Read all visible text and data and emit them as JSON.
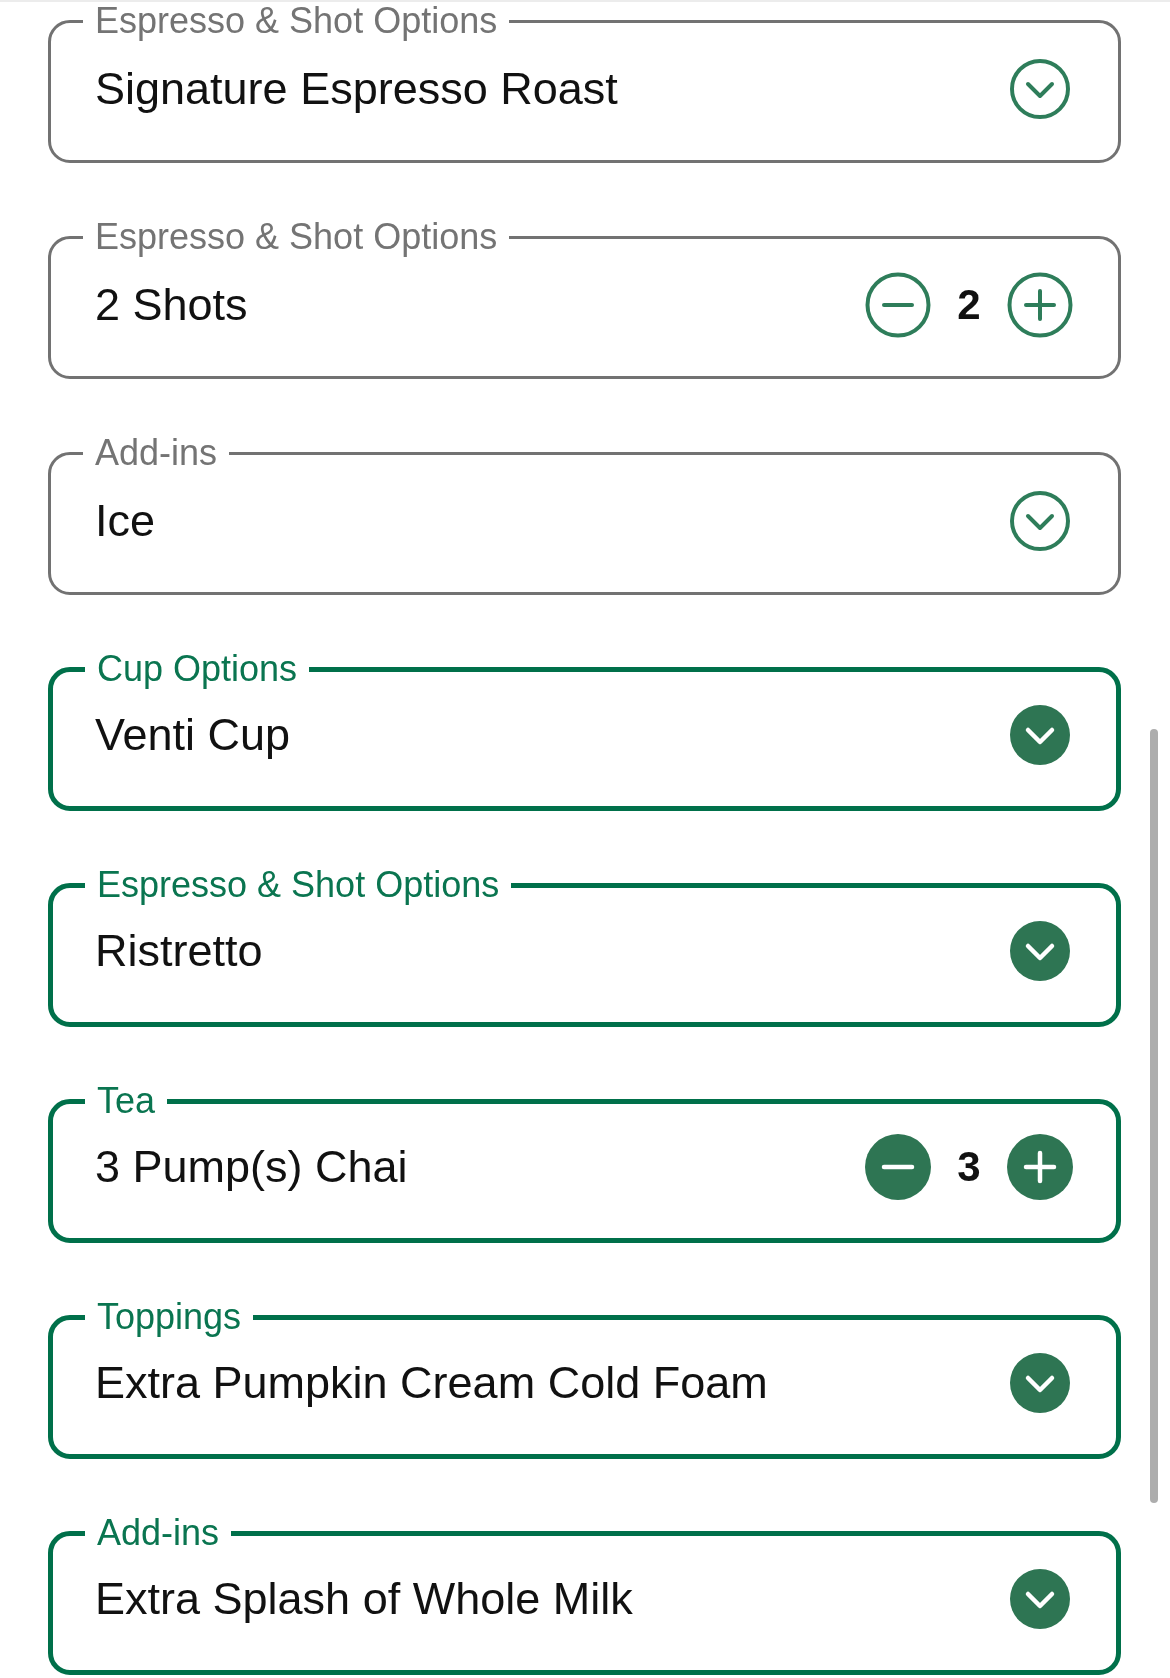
{
  "options": [
    {
      "kind": "select",
      "label": "Espresso & Shot Options",
      "value": "Signature Espresso Roast",
      "selected": false
    },
    {
      "kind": "stepper",
      "label": "Espresso & Shot Options",
      "value": "2 Shots",
      "count": "2",
      "selected": false
    },
    {
      "kind": "select",
      "label": "Add-ins",
      "value": "Ice",
      "selected": false
    },
    {
      "kind": "select",
      "label": "Cup Options",
      "value": "Venti Cup",
      "selected": true
    },
    {
      "kind": "select",
      "label": "Espresso & Shot Options",
      "value": "Ristretto",
      "selected": true
    },
    {
      "kind": "stepper",
      "label": "Tea",
      "value": "3 Pump(s) Chai",
      "count": "3",
      "selected": true
    },
    {
      "kind": "select",
      "label": "Toppings",
      "value": "Extra Pumpkin Cream Cold Foam",
      "selected": true
    },
    {
      "kind": "select",
      "label": "Add-ins",
      "value": "Extra Splash of Whole Milk",
      "selected": true
    }
  ]
}
